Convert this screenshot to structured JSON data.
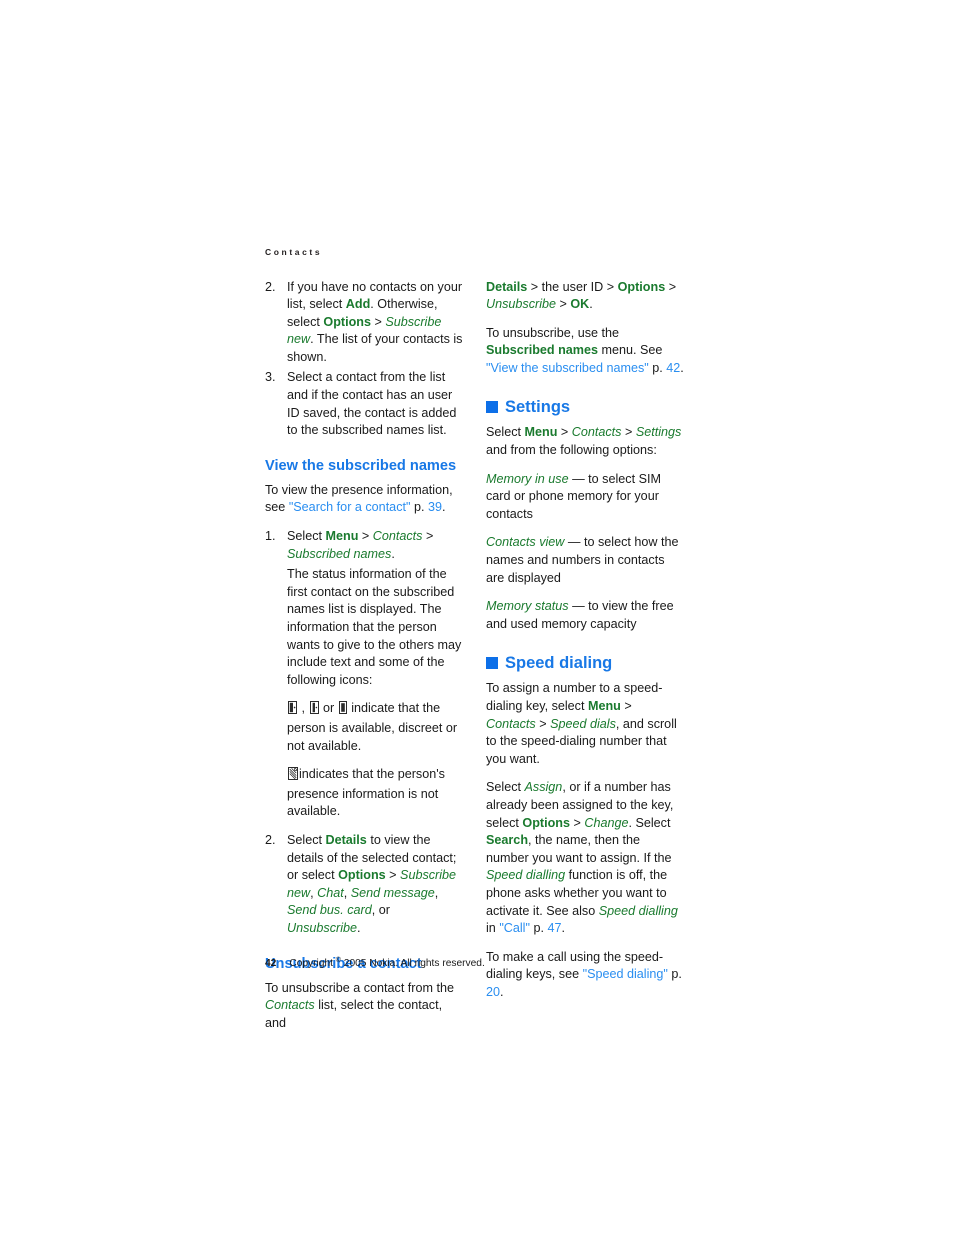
{
  "header": {
    "running_title": "Contacts"
  },
  "footer": {
    "page_number": "42",
    "copyright_pre": "Copyright ",
    "copyright_symbol": "©",
    "copyright_post": " 2005 Nokia. All rights reserved."
  },
  "left_column": {
    "steps_top": [
      {
        "num": "2.",
        "segments": [
          {
            "t": "If you have no contacts on your list, select ",
            "s": "plain"
          },
          {
            "t": "Add",
            "s": "bold"
          },
          {
            "t": ". Otherwise, select ",
            "s": "plain"
          },
          {
            "t": "Options",
            "s": "bold"
          },
          {
            "t": " > ",
            "s": "gt"
          },
          {
            "t": "Subscribe new",
            "s": "italic"
          },
          {
            "t": ". The list of your contacts is shown.",
            "s": "plain"
          }
        ]
      },
      {
        "num": "3.",
        "segments": [
          {
            "t": "Select a contact from the list and if the contact has an user ID saved, the contact is added to the subscribed names list.",
            "s": "plain"
          }
        ]
      }
    ],
    "heading_view": "View the subscribed names",
    "view_intro": {
      "segments": [
        {
          "t": "To view the presence information, see ",
          "s": "plain"
        },
        {
          "t": "\"Search for a contact\"",
          "s": "link"
        },
        {
          "t": " p. ",
          "s": "plain"
        },
        {
          "t": "39",
          "s": "page"
        },
        {
          "t": ".",
          "s": "plain"
        }
      ]
    },
    "step1": {
      "num": "1.",
      "segments": [
        {
          "t": "Select ",
          "s": "plain"
        },
        {
          "t": "Menu",
          "s": "bold"
        },
        {
          "t": " > ",
          "s": "gt"
        },
        {
          "t": "Contacts",
          "s": "italic"
        },
        {
          "t": " > ",
          "s": "gt"
        },
        {
          "t": "Subscribed names",
          "s": "italic"
        },
        {
          "t": ".",
          "s": "plain"
        }
      ]
    },
    "step1_body": "The status information of the first contact on the subscribed names list is displayed. The information that the person wants to give to the others may include text and some of the following icons:",
    "icon_line_1": {
      "icons": [
        "presence-available-icon",
        "presence-discreet-icon",
        "presence-not-available-icon"
      ],
      "sep1": " , ",
      "sep2": " or ",
      "text": " indicate that the person is available, discreet or not available."
    },
    "icon_line_2": {
      "icon": "presence-unknown-icon",
      "text": "indicates that the person's presence information is not available."
    },
    "step2": {
      "num": "2.",
      "segments": [
        {
          "t": "Select ",
          "s": "plain"
        },
        {
          "t": "Details",
          "s": "bold"
        },
        {
          "t": " to view the details of the selected contact; or select ",
          "s": "plain"
        },
        {
          "t": "Options",
          "s": "bold"
        },
        {
          "t": " > ",
          "s": "gt"
        },
        {
          "t": "Subscribe new",
          "s": "italic"
        },
        {
          "t": ", ",
          "s": "plain"
        },
        {
          "t": "Chat",
          "s": "italic"
        },
        {
          "t": ", ",
          "s": "plain"
        },
        {
          "t": "Send message",
          "s": "italic"
        },
        {
          "t": ", ",
          "s": "plain"
        },
        {
          "t": "Send bus. card",
          "s": "italic"
        },
        {
          "t": ", or ",
          "s": "plain"
        },
        {
          "t": "Unsubscribe",
          "s": "italic"
        },
        {
          "t": ".",
          "s": "plain"
        }
      ]
    },
    "heading_unsubscribe": "Unsubscribe a contact",
    "unsubscribe_body": {
      "segments": [
        {
          "t": "To unsubscribe a contact from the ",
          "s": "plain"
        },
        {
          "t": "Contacts",
          "s": "italic"
        },
        {
          "t": " list, select the contact, and",
          "s": "plain"
        }
      ]
    }
  },
  "right_column": {
    "continuation": {
      "segments": [
        {
          "t": "Details",
          "s": "bold"
        },
        {
          "t": " > the user ID > ",
          "s": "plain"
        },
        {
          "t": "Options",
          "s": "bold"
        },
        {
          "t": " > ",
          "s": "gt"
        },
        {
          "t": "Unsubscribe",
          "s": "italic"
        },
        {
          "t": " > ",
          "s": "gt"
        },
        {
          "t": "OK",
          "s": "bold"
        },
        {
          "t": ".",
          "s": "plain"
        }
      ]
    },
    "unsubscribe_note": {
      "segments": [
        {
          "t": "To unsubscribe, use the ",
          "s": "plain"
        },
        {
          "t": "Subscribed names",
          "s": "bold"
        },
        {
          "t": " menu. See ",
          "s": "plain"
        },
        {
          "t": "\"View the subscribed names\"",
          "s": "link"
        },
        {
          "t": " p. ",
          "s": "plain"
        },
        {
          "t": "42",
          "s": "page"
        },
        {
          "t": ".",
          "s": "plain"
        }
      ]
    },
    "heading_settings": "Settings",
    "settings_intro": {
      "segments": [
        {
          "t": "Select ",
          "s": "plain"
        },
        {
          "t": "Menu",
          "s": "bold"
        },
        {
          "t": " > ",
          "s": "gt"
        },
        {
          "t": "Contacts",
          "s": "italic"
        },
        {
          "t": " > ",
          "s": "gt"
        },
        {
          "t": "Settings",
          "s": "italic"
        },
        {
          "t": " and from the following options:",
          "s": "plain"
        }
      ]
    },
    "settings_options": [
      {
        "segments": [
          {
            "t": "Memory in use",
            "s": "italic"
          },
          {
            "t": " — to select SIM card or phone memory for your contacts",
            "s": "plain"
          }
        ]
      },
      {
        "segments": [
          {
            "t": "Contacts view",
            "s": "italic"
          },
          {
            "t": " — to select how the names and numbers in contacts are displayed",
            "s": "plain"
          }
        ]
      },
      {
        "segments": [
          {
            "t": "Memory status",
            "s": "italic"
          },
          {
            "t": " — to view the free and used memory capacity",
            "s": "plain"
          }
        ]
      }
    ],
    "heading_speed_dialing": "Speed dialing",
    "speed_para_1": {
      "segments": [
        {
          "t": "To assign a number to a speed-dialing key, select ",
          "s": "plain"
        },
        {
          "t": "Menu",
          "s": "bold"
        },
        {
          "t": " > ",
          "s": "gt"
        },
        {
          "t": "Contacts",
          "s": "italic"
        },
        {
          "t": " > ",
          "s": "gt"
        },
        {
          "t": "Speed dials",
          "s": "italic"
        },
        {
          "t": ", and scroll to the speed-dialing number that you want.",
          "s": "plain"
        }
      ]
    },
    "speed_para_2": {
      "segments": [
        {
          "t": "Select ",
          "s": "plain"
        },
        {
          "t": "Assign",
          "s": "italic"
        },
        {
          "t": ", or if a number has already been assigned to the key, select ",
          "s": "plain"
        },
        {
          "t": "Options",
          "s": "bold"
        },
        {
          "t": " > ",
          "s": "gt"
        },
        {
          "t": "Change",
          "s": "italic"
        },
        {
          "t": ". Select ",
          "s": "plain"
        },
        {
          "t": "Search",
          "s": "bold"
        },
        {
          "t": ", the name, then the number you want to assign. If the ",
          "s": "plain"
        },
        {
          "t": "Speed dialling",
          "s": "italic"
        },
        {
          "t": " function is off, the phone asks whether you want to activate it. See also ",
          "s": "plain"
        },
        {
          "t": "Speed dialling",
          "s": "italic"
        },
        {
          "t": " in ",
          "s": "plain"
        },
        {
          "t": "\"Call\"",
          "s": "link"
        },
        {
          "t": " p. ",
          "s": "plain"
        },
        {
          "t": "47",
          "s": "page"
        },
        {
          "t": ".",
          "s": "plain"
        }
      ]
    },
    "speed_para_3": {
      "segments": [
        {
          "t": "To make a call using the speed-dialing keys, see ",
          "s": "plain"
        },
        {
          "t": "\"Speed dialing\"",
          "s": "link"
        },
        {
          "t": " p. ",
          "s": "plain"
        },
        {
          "t": "20",
          "s": "page"
        },
        {
          "t": ".",
          "s": "plain"
        }
      ]
    }
  },
  "colors": {
    "heading_blue": "#1878e6",
    "square_blue": "#0d6fe8",
    "link_blue": "#2a8ef0",
    "command_green": "#1a7a2e",
    "body_text": "#1a1a1a"
  }
}
